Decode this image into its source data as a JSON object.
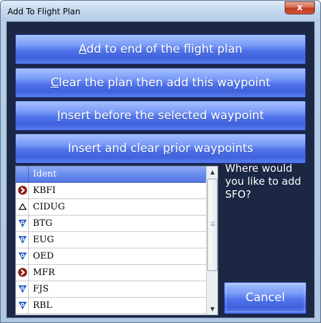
{
  "window": {
    "title": "Add To Flight Plan",
    "close_label": "x"
  },
  "actions": [
    {
      "pre": "",
      "accel": "A",
      "post": "dd to end of the flight plan"
    },
    {
      "pre": "",
      "accel": "C",
      "post": "lear the plan then add this waypoint"
    },
    {
      "pre": "",
      "accel": "I",
      "post": "nsert before the selected waypoint"
    },
    {
      "pre": "Insert and clear ",
      "accel": "p",
      "post": "rior waypoints"
    }
  ],
  "list": {
    "header": "Ident",
    "rows": [
      {
        "ident": "KBFI",
        "icon": "airport-icon"
      },
      {
        "ident": "CIDUG",
        "icon": "intersection-icon"
      },
      {
        "ident": "BTG",
        "icon": "vor-icon"
      },
      {
        "ident": "EUG",
        "icon": "vor-icon"
      },
      {
        "ident": "OED",
        "icon": "vor-icon"
      },
      {
        "ident": "MFR",
        "icon": "airport-icon"
      },
      {
        "ident": "FJS",
        "icon": "vor-icon"
      },
      {
        "ident": "RBL",
        "icon": "vor-icon"
      }
    ]
  },
  "prompt": "Where would you like to add SFO?",
  "cancel_label": "Cancel",
  "colors": {
    "client_bg": "#1c2744",
    "button_blue": "#4f73ea",
    "airport_red": "#8e1a12",
    "vor_blue": "#1f57c9"
  }
}
